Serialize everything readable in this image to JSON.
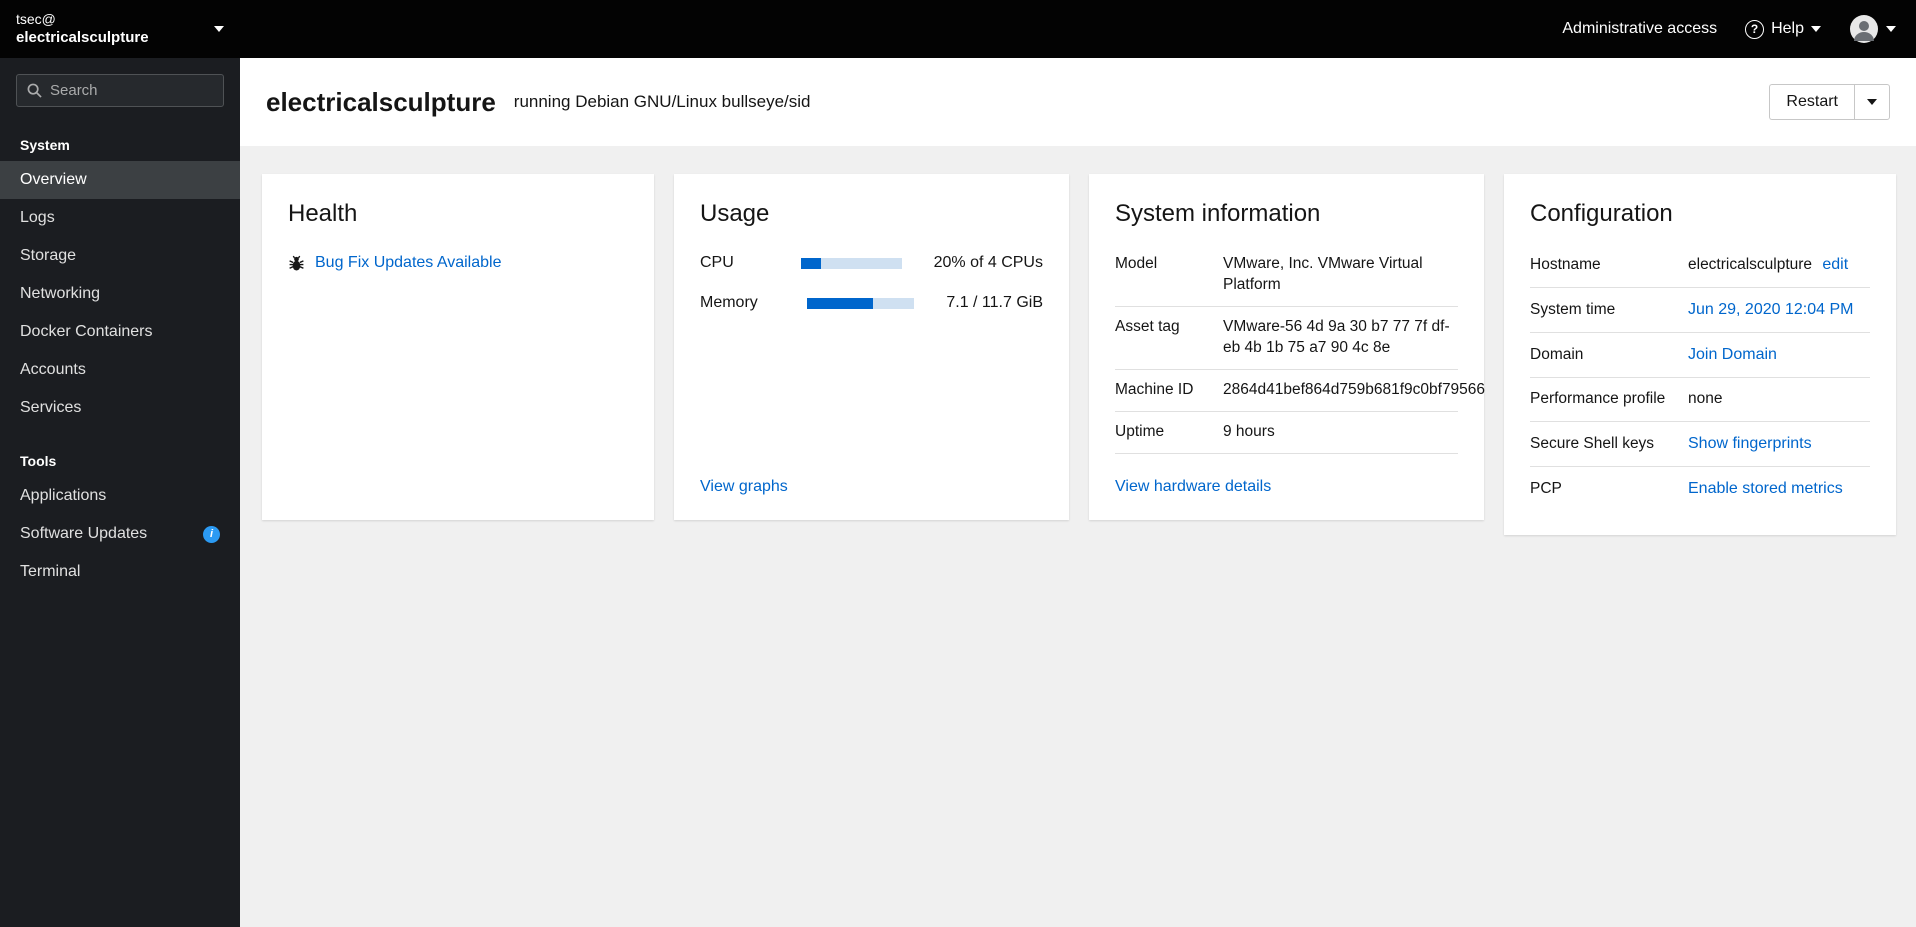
{
  "colors": {
    "accent": "#0066cc",
    "link": "#0066cc",
    "progress_fill": "#0066cc",
    "sidebar_bg": "#1b1d21",
    "topbar_bg": "#030303"
  },
  "sidebar": {
    "user_line1": "tsec@",
    "user_line2": "electricalsculpture",
    "search_placeholder": "Search",
    "sections": [
      {
        "label": "System",
        "items": [
          {
            "label": "Overview",
            "active": true
          },
          {
            "label": "Logs"
          },
          {
            "label": "Storage"
          },
          {
            "label": "Networking"
          },
          {
            "label": "Docker Containers"
          },
          {
            "label": "Accounts"
          },
          {
            "label": "Services"
          }
        ]
      },
      {
        "label": "Tools",
        "items": [
          {
            "label": "Applications"
          },
          {
            "label": "Software Updates",
            "badge": "info"
          },
          {
            "label": "Terminal"
          }
        ]
      }
    ]
  },
  "topbar": {
    "administrative_access": "Administrative access",
    "help_label": "Help"
  },
  "header": {
    "hostname": "electricalsculpture",
    "os": "running Debian GNU/Linux bullseye/sid",
    "restart_label": "Restart"
  },
  "health": {
    "title": "Health",
    "updates_link": "Bug Fix Updates Available"
  },
  "usage": {
    "title": "Usage",
    "cpu_label": "CPU",
    "cpu_value": "20% of 4 CPUs",
    "cpu_percent": 20,
    "memory_label": "Memory",
    "memory_value": "7.1 / 11.7 GiB",
    "memory_percent": 61,
    "view_graphs": "View graphs"
  },
  "system_info": {
    "title": "System information",
    "model": {
      "label": "Model",
      "value": "VMware, Inc. VMware Virtual Platform"
    },
    "asset_tag": {
      "label": "Asset tag",
      "value": "VMware-56 4d 9a 30 b7 77 7f df-eb 4b 1b 75 a7 90 4c 8e"
    },
    "machine_id": {
      "label": "Machine ID",
      "value": "2864d41bef864d759b681f9c0bf79566"
    },
    "uptime": {
      "label": "Uptime",
      "value": "9 hours"
    },
    "link": "View hardware details"
  },
  "configuration": {
    "title": "Configuration",
    "hostname": {
      "label": "Hostname",
      "value": "electricalsculpture",
      "edit": "edit"
    },
    "system_time": {
      "label": "System time",
      "value": "Jun 29, 2020 12:04 PM"
    },
    "domain": {
      "label": "Domain",
      "value": "Join Domain"
    },
    "performance": {
      "label": "Performance profile",
      "value": "none"
    },
    "ssh": {
      "label": "Secure Shell keys",
      "value": "Show fingerprints"
    },
    "pcp": {
      "label": "PCP",
      "value": "Enable stored metrics"
    }
  }
}
